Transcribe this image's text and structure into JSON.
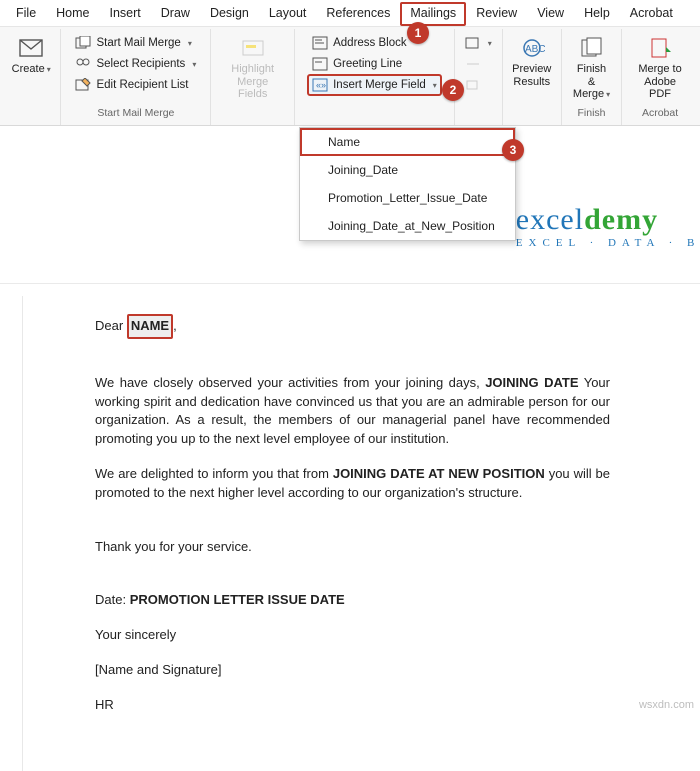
{
  "menu": {
    "items": [
      "File",
      "Home",
      "Insert",
      "Draw",
      "Design",
      "Layout",
      "References",
      "Mailings",
      "Review",
      "View",
      "Help",
      "Acrobat"
    ],
    "active": "Mailings"
  },
  "ribbon": {
    "create": {
      "label": "Create"
    },
    "start_group_label": "Start Mail Merge",
    "start_items": {
      "start_mail_merge": "Start Mail Merge",
      "select_recipients": "Select Recipients",
      "edit_recipient_list": "Edit Recipient List"
    },
    "highlight": {
      "label": "Highlight\nMerge Fields"
    },
    "write_items": {
      "address_block": "Address Block",
      "greeting_line": "Greeting Line",
      "insert_merge_field": "Insert Merge Field"
    },
    "preview": {
      "label": "Preview\nResults"
    },
    "finish": {
      "label": "Finish &\nMerge",
      "group": "Finish"
    },
    "acrobat": {
      "label": "Merge to\nAdobe PDF",
      "group": "Acrobat"
    }
  },
  "merge_fields": [
    "Name",
    "Joining_Date",
    "Promotion_Letter_Issue_Date",
    "Joining_Date_at_New_Position"
  ],
  "doc": {
    "dear": "Dear",
    "name_field": "NAME",
    "p1a": "We have closely observed your activities from your joining days, ",
    "joining_date": "JOINING DATE",
    "p1b": " Your working spirit and dedication have convinced us that you are an admirable person for our organization. As a result, the members of our managerial panel have recommended promoting you up to the next level employee of our institution.",
    "p2a": "We are delighted to inform you that from ",
    "new_pos": "JOINING DATE AT NEW POSITION",
    "p2b": " you will be promoted to the next higher level according to our organization's structure.",
    "thanks": "Thank you for your service.",
    "date_label": "Date: ",
    "issue_date": "PROMOTION LETTER ISSUE DATE",
    "sincerely": "Your sincerely",
    "sig": "[Name and Signature]",
    "hr": "HR"
  },
  "logo": {
    "brand_a": "excel",
    "brand_b": "demy",
    "tag": "EXCEL · DATA · BI"
  },
  "watermark": "wsxdn.com",
  "colors": {
    "accent": "#c0392b"
  }
}
